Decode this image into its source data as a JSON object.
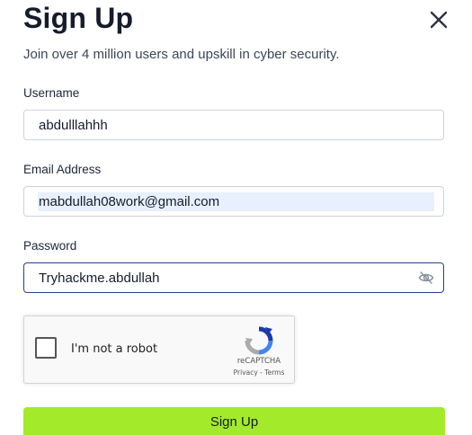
{
  "header": {
    "title": "Sign Up",
    "subtitle": "Join over 4 million users and upskill in cyber security."
  },
  "form": {
    "username": {
      "label": "Username",
      "value": "abdulllahhh"
    },
    "email": {
      "label": "Email Address",
      "value": "mabdullah08work@gmail.com"
    },
    "password": {
      "label": "Password",
      "value": "Tryhackme.abdullah"
    },
    "submit_label": "Sign Up"
  },
  "captcha": {
    "checkbox_label": "I'm not a robot",
    "brand": "reCAPTCHA",
    "links": "Privacy - Terms"
  },
  "colors": {
    "accent": "#a3ea2a",
    "focus_border": "#2a3f8f",
    "autofill_bg": "#e8f0fe"
  },
  "icons": {
    "close": "close-icon",
    "password_toggle": "eye-slash-icon",
    "recaptcha": "recaptcha-logo-icon"
  }
}
